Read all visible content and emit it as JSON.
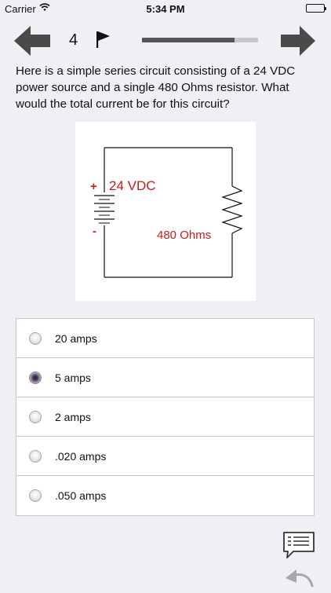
{
  "status_bar": {
    "carrier": "Carrier",
    "time": "5:34 PM"
  },
  "nav": {
    "question_number": "4",
    "progress_percent": 80
  },
  "question": {
    "text": "Here is a simple series circuit consisting of a 24 VDC power source and a single 480 Ohms resistor. What would the total current be for this circuit?"
  },
  "circuit": {
    "plus": "+",
    "minus": "-",
    "voltage_label": "24 VDC",
    "resistor_label": "480 Ohms",
    "label_color": "#cc1a1a"
  },
  "answers": [
    {
      "label": "20 amps",
      "selected": false
    },
    {
      "label": "5 amps",
      "selected": true
    },
    {
      "label": "2 amps",
      "selected": false
    },
    {
      "label": ".020 amps",
      "selected": false
    },
    {
      "label": ".050 amps",
      "selected": false
    }
  ],
  "icons": {
    "back": "left-arrow-icon",
    "forward": "right-arrow-icon",
    "flag": "flag-icon",
    "comment": "comment-icon",
    "undo": "undo-icon",
    "wifi": "wifi-icon",
    "battery": "battery-icon"
  }
}
